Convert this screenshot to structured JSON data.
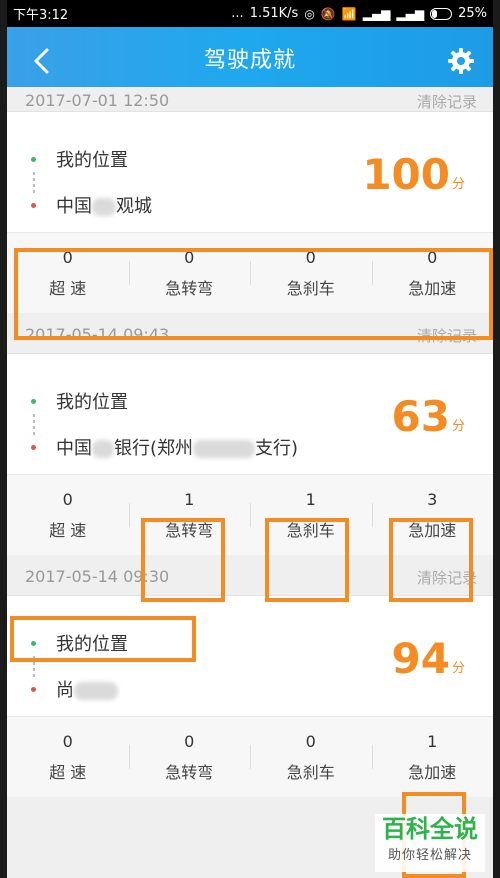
{
  "status_bar": {
    "time": "下午3:12",
    "dots": "...",
    "speed": "1.51K/s",
    "battery": "25%"
  },
  "header": {
    "title": "驾驶成就",
    "back_icon": "chevron-left-icon",
    "settings_icon": "gear-icon"
  },
  "records": [
    {
      "date": "2017-07-01 12:50",
      "clear": "清除记录",
      "start": "我的位置",
      "end_a": "中国",
      "end_b": "观城",
      "score": "100",
      "unit": "分",
      "stats": [
        {
          "value": "0",
          "label": "超 速"
        },
        {
          "value": "0",
          "label": "急转弯"
        },
        {
          "value": "0",
          "label": "急刹车"
        },
        {
          "value": "0",
          "label": "急加速"
        }
      ]
    },
    {
      "date": "2017-05-14 09:43",
      "clear": "清除记录",
      "start": "我的位置",
      "end_a": "中国",
      "end_b": "银行(郑州",
      "end_c": "支行)",
      "score": "63",
      "unit": "分",
      "stats": [
        {
          "value": "0",
          "label": "超 速"
        },
        {
          "value": "1",
          "label": "急转弯"
        },
        {
          "value": "1",
          "label": "急刹车"
        },
        {
          "value": "3",
          "label": "急加速"
        }
      ]
    },
    {
      "date": "2017-05-14 09:30",
      "clear": "清除记录",
      "start": "我的位置",
      "end_a": "尚",
      "score": "94",
      "unit": "分",
      "stats": [
        {
          "value": "0",
          "label": "超 速"
        },
        {
          "value": "0",
          "label": "急转弯"
        },
        {
          "value": "0",
          "label": "急刹车"
        },
        {
          "value": "1",
          "label": "急加速"
        }
      ]
    }
  ],
  "watermark": {
    "main": "百科全说",
    "sub": "助你轻松解决"
  }
}
